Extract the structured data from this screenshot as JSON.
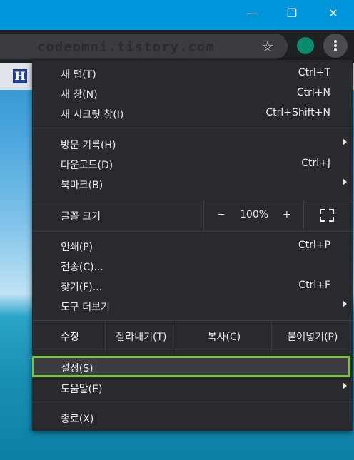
{
  "window": {
    "minimize_glyph": "—",
    "restore_glyph": "❐",
    "close_glyph": "✕"
  },
  "omnibox": {
    "text": "codeomni.tistory.com"
  },
  "bookmark": {
    "icon_letter": "H"
  },
  "menu": {
    "new_tab": {
      "label": "새 탭(T)",
      "shortcut": "Ctrl+T"
    },
    "new_window": {
      "label": "새 창(N)",
      "shortcut": "Ctrl+N"
    },
    "incognito": {
      "label": "새 시크릿 창(I)",
      "shortcut": "Ctrl+Shift+N"
    },
    "history": {
      "label": "방문 기록(H)"
    },
    "downloads": {
      "label": "다운로드(D)",
      "shortcut": "Ctrl+J"
    },
    "bookmarks": {
      "label": "북마크(B)"
    },
    "zoom": {
      "label": "글꼴 크기",
      "minus": "−",
      "value": "100%",
      "plus": "+"
    },
    "print": {
      "label": "인쇄(P)",
      "shortcut": "Ctrl+P"
    },
    "cast": {
      "label": "전송(C)..."
    },
    "find": {
      "label": "찾기(F)...",
      "shortcut": "Ctrl+F"
    },
    "more_tools": {
      "label": "도구 더보기"
    },
    "edit": {
      "label": "수정",
      "cut": "잘라내기(T)",
      "copy": "복사(C)",
      "paste": "붙여넣기(P)"
    },
    "settings": {
      "label": "설정(S)"
    },
    "help": {
      "label": "도움말(E)"
    },
    "exit": {
      "label": "종료(X)"
    }
  },
  "colors": {
    "highlight_border": "#7ac142",
    "menu_bg": "#292a2d"
  }
}
